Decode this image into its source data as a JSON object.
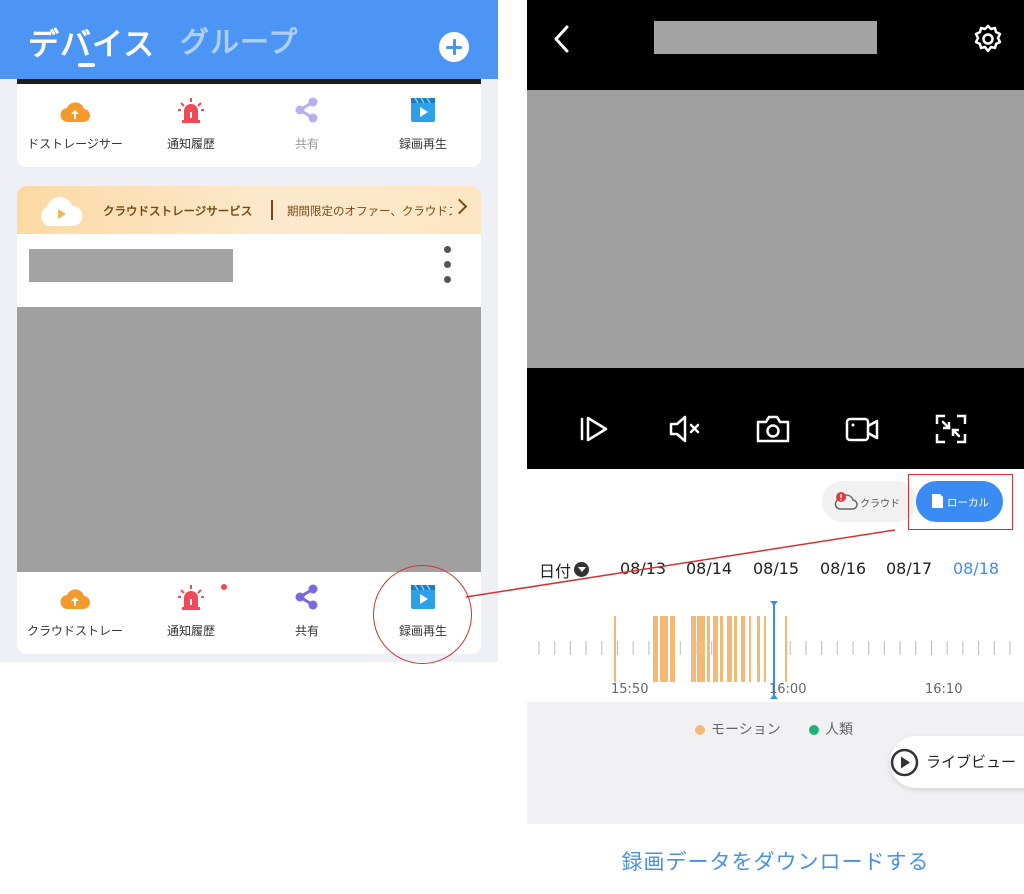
{
  "left_screen": {
    "header": {
      "active_tab": "デバイス",
      "inactive_tab": "グループ",
      "add_icon": "plus-circle-icon"
    },
    "device_card_top": {
      "actions": [
        {
          "label": "ドストレージサー",
          "icon": "cloud-storage-icon"
        },
        {
          "label": "通知履歴",
          "icon": "alarm-siren-icon"
        },
        {
          "label": "共有",
          "icon": "share-icon",
          "disabled": true
        },
        {
          "label": "録画再生",
          "icon": "video-playback-icon"
        }
      ]
    },
    "device_card": {
      "promo_text": "クラウドストレージサービス",
      "promo_sub": "期間限定のオファー、クラウドストレージ",
      "actions": [
        {
          "label": "クラウドストレー",
          "icon": "cloud-storage-icon"
        },
        {
          "label": "通知履歴",
          "icon": "alarm-siren-icon",
          "badge": true
        },
        {
          "label": "共有",
          "icon": "share-icon"
        },
        {
          "label": "録画再生",
          "icon": "video-playback-icon"
        }
      ]
    }
  },
  "right_screen": {
    "storage_toggle": {
      "cloud_label": "クラウド",
      "local_label": "ローカル",
      "selected": "ローカル"
    },
    "date_bar": {
      "label": "日付",
      "dates": [
        "08/13",
        "08/14",
        "08/15",
        "08/16",
        "08/17",
        "08/18"
      ],
      "selected": "08/18"
    },
    "timeline": {
      "time_labels": [
        "15:50",
        "16:00",
        "16:10"
      ],
      "cursor_time": "16:00"
    },
    "legend": [
      {
        "label": "モーション",
        "color": "#f4b877"
      },
      {
        "label": "人類",
        "color": "#1fb27a"
      }
    ],
    "live_view_label": "ライブビュー",
    "download_label": "録画データをダウンロードする"
  },
  "colors": {
    "primary_blue": "#4d95f4",
    "selected_blue": "#3b8cf2",
    "motion_orange": "#f4b877",
    "annotation_red": "#d33131"
  }
}
